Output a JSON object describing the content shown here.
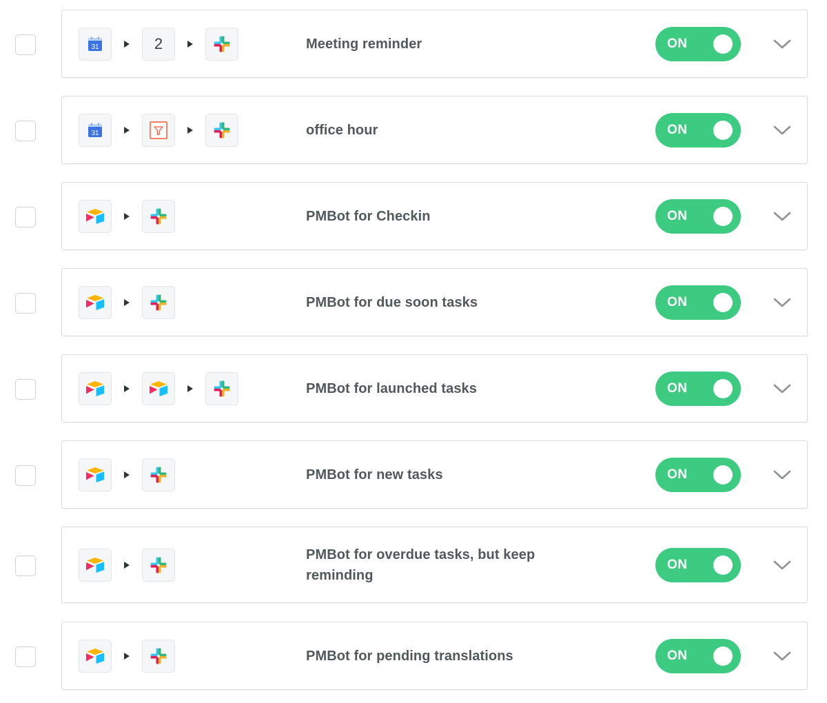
{
  "zaps": [
    {
      "title": "Meeting reminder",
      "toggle_label": "ON",
      "enabled": true,
      "steps": [
        "google-calendar",
        "step-count",
        "slack"
      ],
      "step_count_label": "2"
    },
    {
      "title": "office hour",
      "toggle_label": "ON",
      "enabled": true,
      "steps": [
        "google-calendar",
        "filter",
        "slack"
      ]
    },
    {
      "title": "PMBot for Checkin",
      "toggle_label": "ON",
      "enabled": true,
      "steps": [
        "airtable",
        "slack"
      ]
    },
    {
      "title": "PMBot for due soon tasks",
      "toggle_label": "ON",
      "enabled": true,
      "steps": [
        "airtable",
        "slack"
      ]
    },
    {
      "title": "PMBot for launched tasks",
      "toggle_label": "ON",
      "enabled": true,
      "steps": [
        "airtable",
        "airtable",
        "slack"
      ]
    },
    {
      "title": "PMBot for new tasks",
      "toggle_label": "ON",
      "enabled": true,
      "steps": [
        "airtable",
        "slack"
      ]
    },
    {
      "title": "PMBot for overdue tasks, but keep reminding",
      "toggle_label": "ON",
      "enabled": true,
      "steps": [
        "airtable",
        "slack"
      ]
    },
    {
      "title": "PMBot for pending translations",
      "toggle_label": "ON",
      "enabled": true,
      "steps": [
        "airtable",
        "slack"
      ]
    }
  ],
  "icons": {
    "arrow": "triangle-right-icon",
    "expand": "chevron-down-icon",
    "google-calendar": "google-calendar-icon",
    "filter": "filter-icon",
    "slack": "slack-icon",
    "airtable": "airtable-icon"
  },
  "colors": {
    "toggle_on": "#3dcb82",
    "title_text": "#51585c",
    "card_border": "#d9dcde",
    "calendar_blue": "#3b73e3",
    "filter_orange": "#ff5a36",
    "airtable_red": "#f82b60",
    "airtable_yellow": "#fcb400",
    "airtable_blue": "#18bfff",
    "slack_blue": "#36c5f0",
    "slack_green": "#2eb67d",
    "slack_red": "#e01e5a",
    "slack_yellow": "#ecb22e"
  }
}
